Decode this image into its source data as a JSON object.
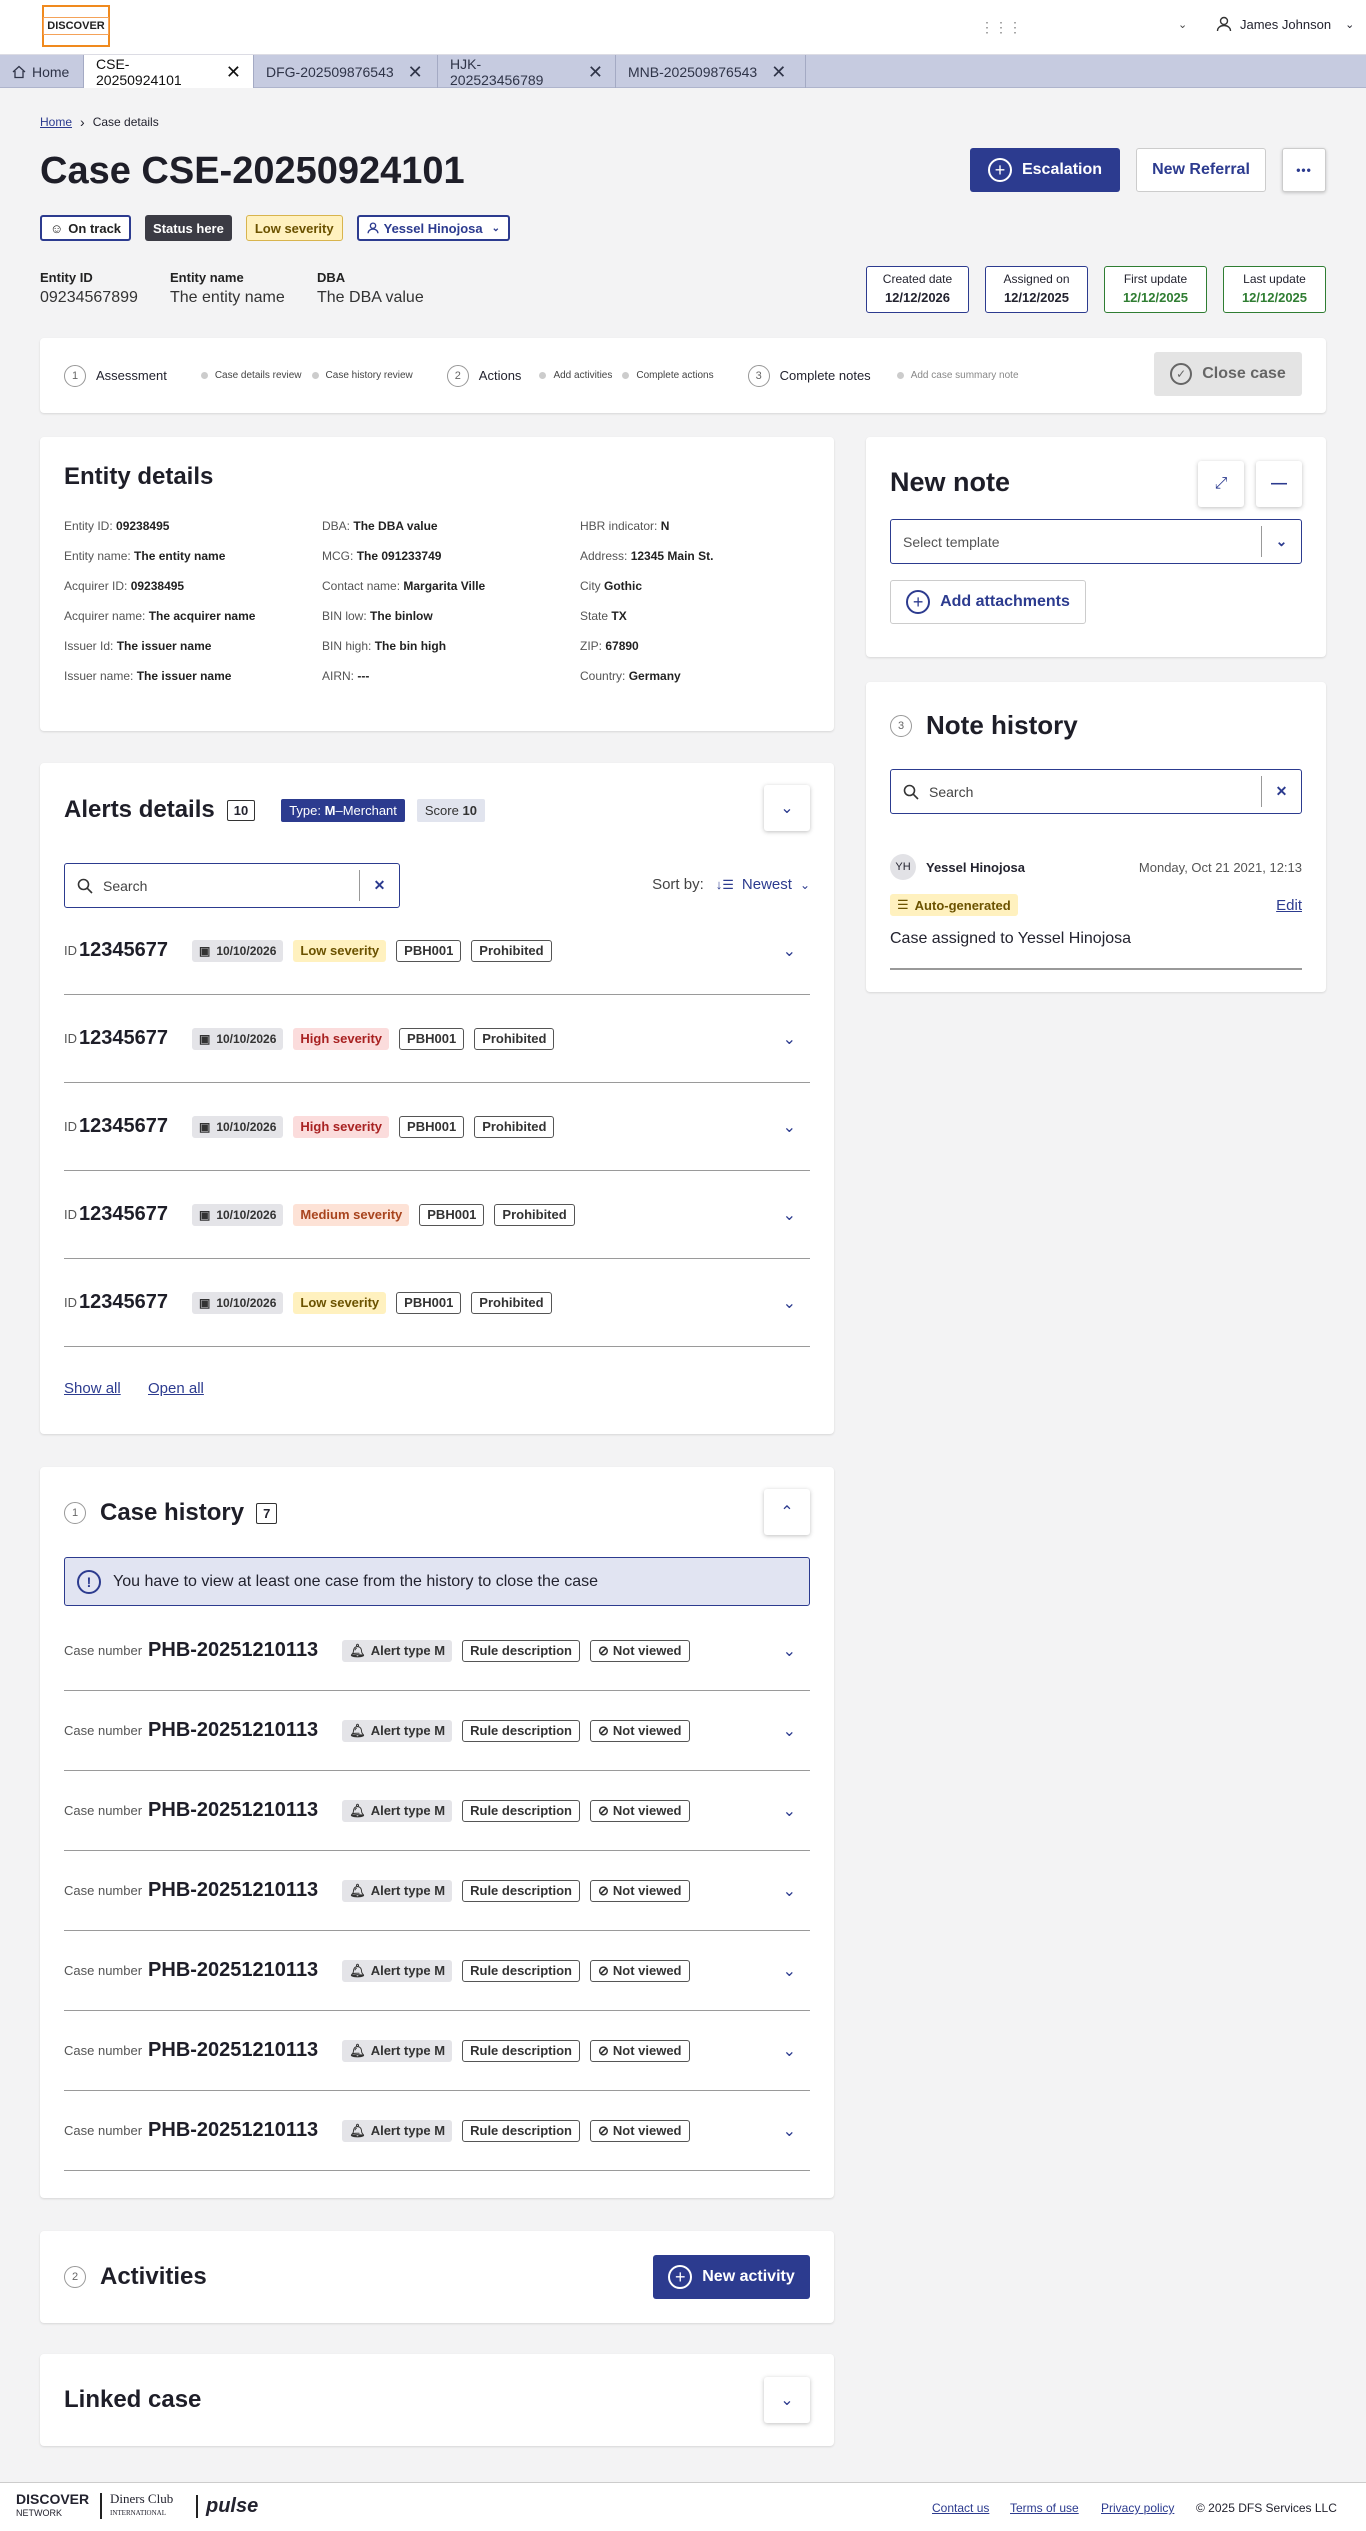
{
  "header": {
    "logo": "DISCOVER",
    "user_name": "James Johnson"
  },
  "tabs": [
    {
      "label": "Home",
      "active": false
    },
    {
      "label": "CSE-20250924101",
      "active": true
    },
    {
      "label": "DFG-202509876543",
      "active": false
    },
    {
      "label": "HJK-202523456789",
      "active": false
    },
    {
      "label": "MNB-202509876543",
      "active": false
    }
  ],
  "breadcrumb": {
    "home": "Home",
    "current": "Case details"
  },
  "title": "Case CSE-20250924101",
  "actions": {
    "escalation": "Escalation",
    "new_referral": "New Referral",
    "more": "•••"
  },
  "status_badges": {
    "track": "On track",
    "status": "Status here",
    "severity": "Low severity",
    "assignee": "Yessel Hinojosa"
  },
  "entity_summary": {
    "id_label": "Entity ID",
    "id_value": "09234567899",
    "name_label": "Entity name",
    "name_value": "The entity name",
    "dba_label": "DBA",
    "dba_value": "The DBA value"
  },
  "dates": [
    {
      "label": "Created date",
      "value": "12/12/2026",
      "color": "blue"
    },
    {
      "label": "Assigned on",
      "value": "12/12/2025",
      "color": "blue"
    },
    {
      "label": "First update",
      "value": "12/12/2025",
      "color": "green"
    },
    {
      "label": "Last update",
      "value": "12/12/2025",
      "color": "green"
    }
  ],
  "steps": {
    "s1": {
      "num": "1",
      "label": "Assessment",
      "sub": [
        "Case details review",
        "Case history review"
      ]
    },
    "s2": {
      "num": "2",
      "label": "Actions",
      "sub": [
        "Add activities",
        "Complete actions"
      ]
    },
    "s3": {
      "num": "3",
      "label": "Complete notes",
      "sub": [
        "Add case summary note"
      ]
    },
    "close": "Close case"
  },
  "entity_details": {
    "title": "Entity details",
    "fields": [
      [
        "Entity ID:",
        "09238495"
      ],
      [
        "DBA:",
        "The DBA value"
      ],
      [
        "HBR indicator:",
        "N"
      ],
      [
        "Entity name:",
        "The entity name"
      ],
      [
        "MCG:",
        "The 091233749"
      ],
      [
        "Address:",
        "12345 Main St."
      ],
      [
        "Acquirer ID:",
        "09238495"
      ],
      [
        "Contact name:",
        "Margarita Ville"
      ],
      [
        "City",
        "Gothic"
      ],
      [
        "Acquirer name:",
        "The acquirer name"
      ],
      [
        "BIN low:",
        "The binlow"
      ],
      [
        "State",
        "TX"
      ],
      [
        "Issuer Id:",
        "The issuer name"
      ],
      [
        "BIN high:",
        "The bin high"
      ],
      [
        "ZIP:",
        "67890"
      ],
      [
        "Issuer name:",
        "The issuer name"
      ],
      [
        "AIRN:",
        "---"
      ],
      [
        "Country:",
        "Germany"
      ]
    ]
  },
  "alerts": {
    "title": "Alerts details",
    "count": "10",
    "type_prefix": "Type: ",
    "type_bold": "M",
    "type_suffix": "–Merchant",
    "score_label": "Score ",
    "score_value": "10",
    "search_placeholder": "Search",
    "sort_label": "Sort by:",
    "sort_value": "Newest",
    "id_label": "ID",
    "show_all": "Show all",
    "open_all": "Open all",
    "rows": [
      {
        "id": "12345677",
        "date": "10/10/2026",
        "severity": "Low severity",
        "sev": "low",
        "code": "PBH001",
        "tag": "Prohibited"
      },
      {
        "id": "12345677",
        "date": "10/10/2026",
        "severity": "High severity",
        "sev": "high",
        "code": "PBH001",
        "tag": "Prohibited"
      },
      {
        "id": "12345677",
        "date": "10/10/2026",
        "severity": "High severity",
        "sev": "high",
        "code": "PBH001",
        "tag": "Prohibited"
      },
      {
        "id": "12345677",
        "date": "10/10/2026",
        "severity": "Medium severity",
        "sev": "med",
        "code": "PBH001",
        "tag": "Prohibited"
      },
      {
        "id": "12345677",
        "date": "10/10/2026",
        "severity": "Low severity",
        "sev": "low",
        "code": "PBH001",
        "tag": "Prohibited"
      }
    ]
  },
  "case_history": {
    "num": "1",
    "title": "Case history",
    "count": "7",
    "info": "You have to view at least one case from the history to close the case",
    "case_label": "Case number",
    "alert_type": "Alert type M",
    "rule": "Rule description",
    "viewed": "Not viewed",
    "rows": [
      "PHB-20251210113",
      "PHB-20251210113",
      "PHB-20251210113",
      "PHB-20251210113",
      "PHB-20251210113",
      "PHB-20251210113",
      "PHB-20251210113"
    ]
  },
  "activities": {
    "num": "2",
    "title": "Activities",
    "new_activity": "New activity"
  },
  "linked_case": {
    "title": "Linked case"
  },
  "new_note": {
    "title": "New note",
    "template_placeholder": "Select template",
    "add_attachments": "Add attachments"
  },
  "note_history": {
    "num": "3",
    "title": "Note history",
    "search_placeholder": "Search",
    "author_initials": "YH",
    "author": "Yessel Hinojosa",
    "date": "Monday, Oct 21 2021, 12:13",
    "auto": "Auto-generated",
    "edit": "Edit",
    "text": "Case assigned to Yessel Hinojosa"
  },
  "footer": {
    "contact": "Contact us",
    "terms": "Terms of use",
    "privacy": "Privacy policy",
    "copyright": "© 2025 DFS Services LLC",
    "brand1": "DISCOVER",
    "brand1b": "NETWORK",
    "brand2": "Diners Club",
    "brand2b": "INTERNATIONAL",
    "brand3": "pulse"
  }
}
